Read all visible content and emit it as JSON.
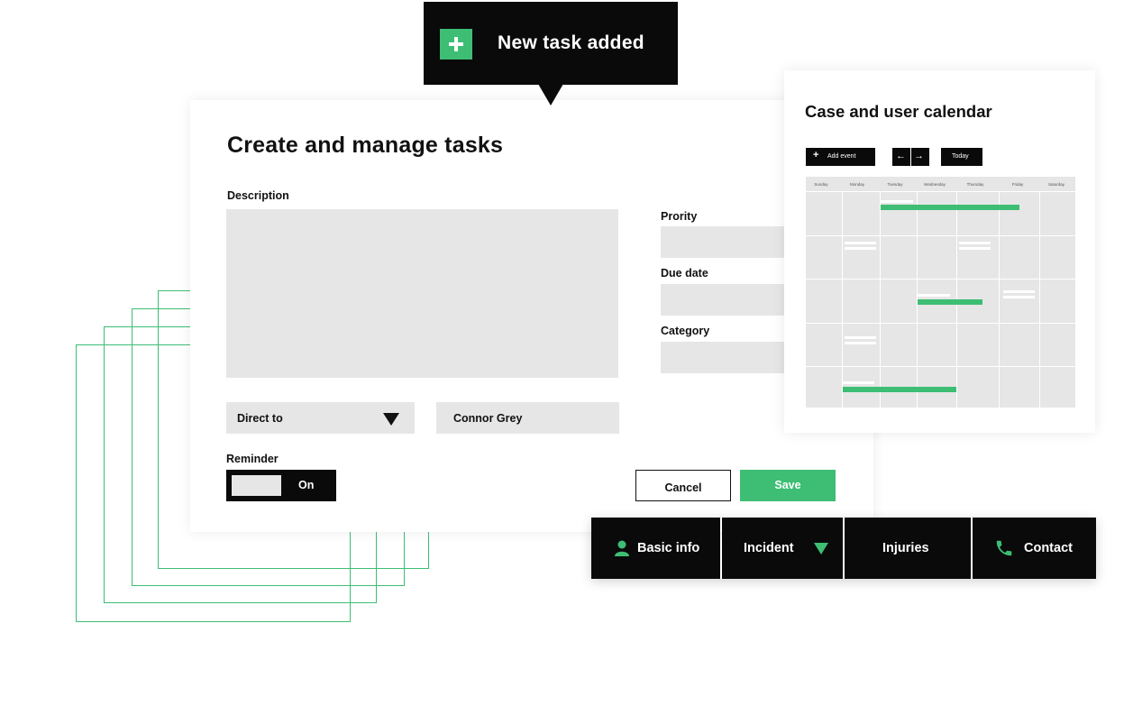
{
  "toast": {
    "message": "New task added"
  },
  "task_form": {
    "title": "Create and manage tasks",
    "description_label": "Description",
    "priority_label": "Prority",
    "due_date_label": "Due date",
    "category_label": "Category",
    "direct_to_label": "Direct to",
    "assignee_value": "Connor Grey",
    "reminder_label": "Reminder",
    "reminder_state": "On",
    "cancel_label": "Cancel",
    "save_label": "Save"
  },
  "calendar": {
    "title": "Case and user calendar",
    "add_event_label": "Add event",
    "prev_glyph": "←",
    "next_glyph": "→",
    "today_label": "Today",
    "days": [
      "Sunday",
      "Monday",
      "Tuesday",
      "Wednesday",
      "Thursday",
      "Friday",
      "Saturday"
    ]
  },
  "tabs": {
    "basic_info": "Basic info",
    "incident": "Incident",
    "injuries": "Injuries",
    "contact": "Contact"
  },
  "colors": {
    "accent": "#3dbe74",
    "dark": "#0a0a0a",
    "field": "#e6e6e6"
  }
}
